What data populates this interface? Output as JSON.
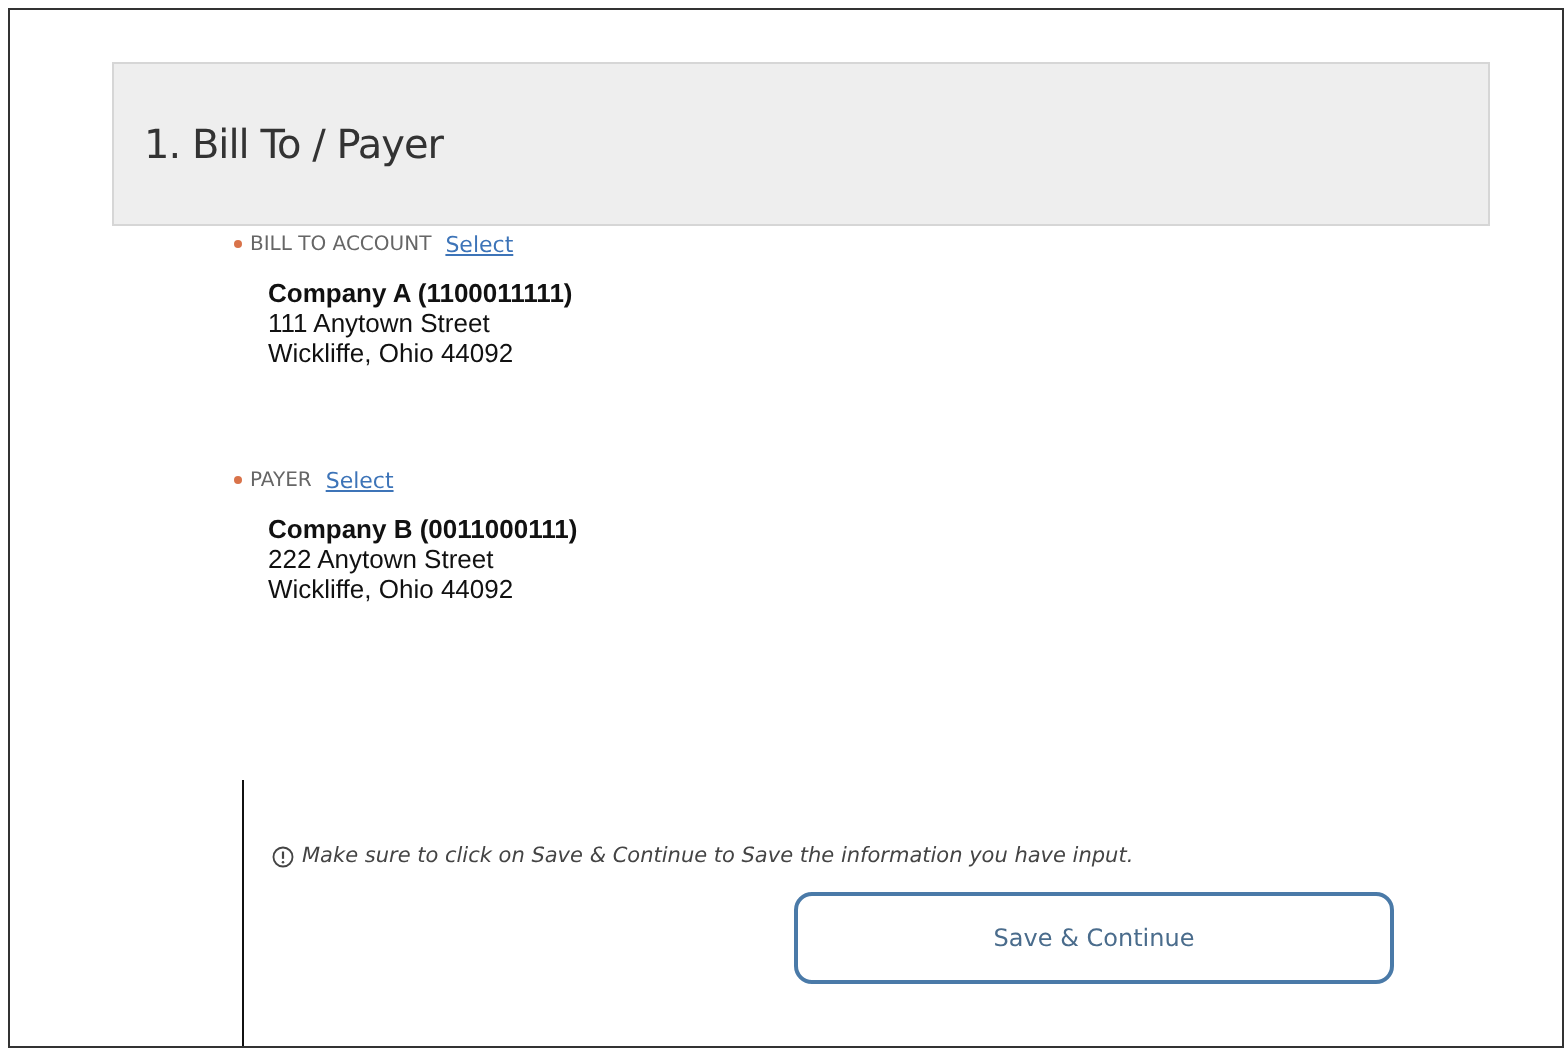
{
  "section": {
    "title": "1. Bill To / Payer"
  },
  "parties": [
    {
      "label": "BILL TO ACCOUNT",
      "link": "Select",
      "name": "Company A (1100011111)",
      "lines": [
        "111 Anytown Street",
        "Wickliffe, Ohio 44092"
      ]
    },
    {
      "label": "PAYER",
      "link": "Select",
      "name": "Company B (0011000111)",
      "lines": [
        "222 Anytown Street",
        "Wickliffe, Ohio 44092"
      ]
    }
  ],
  "note": "Make sure to click on Save & Continue to Save the information you have input.",
  "buttons": [
    "Save & Continue"
  ]
}
